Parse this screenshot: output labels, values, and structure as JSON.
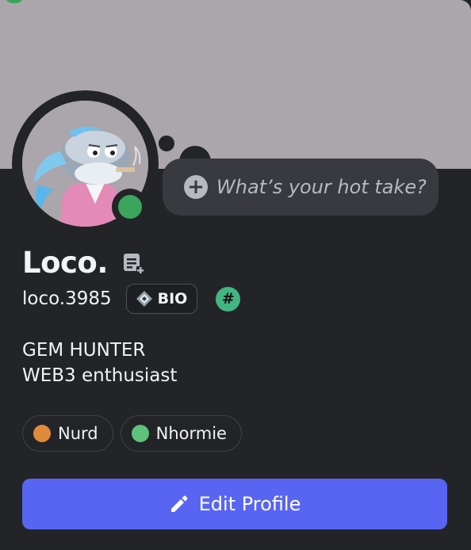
{
  "profile": {
    "display_name": "Loco.",
    "username": "loco.3985",
    "status": "online",
    "status_color": "#3ba55c",
    "banner_color": "#aba6ab",
    "note_icon": "add-note-icon"
  },
  "hot_take": {
    "placeholder": "What’s your hot take?",
    "icon": "plus-circle-icon"
  },
  "badges": {
    "bio_label": "BIO",
    "bio_icon": "diamond-badge-icon",
    "hash_icon": "hashtag-badge-icon",
    "hash_glyph": "#"
  },
  "bio_lines": [
    "GEM HUNTER",
    "WEB3 enthusiast"
  ],
  "roles": [
    {
      "label": "Nurd",
      "color": "#e08a3c"
    },
    {
      "label": "Nhormie",
      "color": "#5ec27a"
    }
  ],
  "edit_button": {
    "label": "Edit Profile",
    "icon": "pencil-icon",
    "color": "#5865f2"
  },
  "plus_glyph": "+"
}
